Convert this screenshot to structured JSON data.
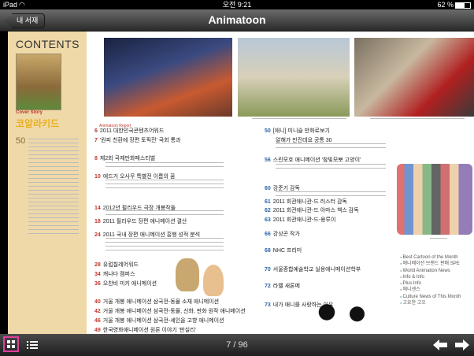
{
  "status": {
    "device": "iPad",
    "time": "오전 9:21",
    "battery": "62 %"
  },
  "nav": {
    "back_label": "내 서재",
    "title": "Animatoon"
  },
  "spine": {
    "contents_title": "CONTENTS",
    "cover_story_label": "Cover Story",
    "cover_story_title": "코알라키드",
    "page_number": "50"
  },
  "toc_left": [
    {
      "num": "6",
      "section": "Animatoon Report",
      "title": "2011 대한민국콘텐츠어워드",
      "sub": "'턴어 친환에 장편 토픽전' 국회 통과"
    },
    {
      "num": "7",
      "title": "'원피 친환에 장편 토픽전' 국회 통과"
    },
    {
      "num": "8",
      "title": "제2회 국제만화페스티벌"
    },
    {
      "num": "10",
      "title": "에드거 오사무 특별전 이름의 꿈"
    },
    {
      "num": "14",
      "title": "2012년 필리우드 극장 개봉작들"
    },
    {
      "num": "18",
      "title": "2011 필리우드 장편 애니메이션 결산"
    },
    {
      "num": "24",
      "title": "2011 국내 장편 애니메이션 흥행 성적 분석"
    },
    {
      "num": "28",
      "title": "유럽칠레어워드"
    },
    {
      "num": "34",
      "title": "캐나다 캠퍼스"
    },
    {
      "num": "36",
      "title": "오찬비 미키 애니메이션"
    },
    {
      "num": "40",
      "title": "거울 개봉 애니메이션 삼국전-동물 소재 애니메이션"
    },
    {
      "num": "42",
      "title": "거울 개봉 애니메이션 삼국전-동물, 신화, 판화 원작 애니메이션"
    },
    {
      "num": "46",
      "title": "거울 개봉 애니메이션 삼국전-셰인을 고향 애니메이션"
    },
    {
      "num": "49",
      "title": "한국영화애니메이션 원론 이야기 '판실리'"
    }
  ],
  "toc_mid": [
    {
      "num": "50",
      "title": "[애니] 미니슬 만화로보기",
      "sub": "알해가 만진데요 공통 30"
    },
    {
      "num": "56",
      "title": "스린모호 애니메이션 '참빛모뽀 고양이'"
    },
    {
      "num": "60",
      "title": "강준기 감독"
    },
    {
      "num": "61",
      "title": "2011 회관애니관-드 러스터 감독"
    },
    {
      "num": "62",
      "title": "2011 회관애니관-드 아마스 책스 감독"
    },
    {
      "num": "63",
      "title": "2011 회관애니관-드-용루이"
    },
    {
      "num": "66",
      "title": "강상곤 작가"
    },
    {
      "num": "68",
      "title": "NHC 프리미"
    },
    {
      "num": "70",
      "title": "서울종합예술학교 실용애니메이션학부"
    },
    {
      "num": "72",
      "title": "라벨 새론메"
    },
    {
      "num": "73",
      "title": "내가 애니를 사랑하는 이유"
    }
  ],
  "right_list": [
    "Best Cartoon of the Month",
    "애니메이션 브랜드 판매 SPE",
    "World Animation News",
    "Info & Info",
    "Plus Info",
    "애니센스",
    "Culture News of This Month",
    "고요한 고오"
  ],
  "page_counter": "7 / 96",
  "toolbar": {
    "grid_icon": "grid-icon",
    "list_icon": "list-icon",
    "prev_icon": "arrow-left-icon",
    "next_icon": "arrow-right-icon"
  },
  "colors": {
    "accent": "#c0392b",
    "spine": "#efd9a8",
    "highlight": "#e0409a"
  }
}
